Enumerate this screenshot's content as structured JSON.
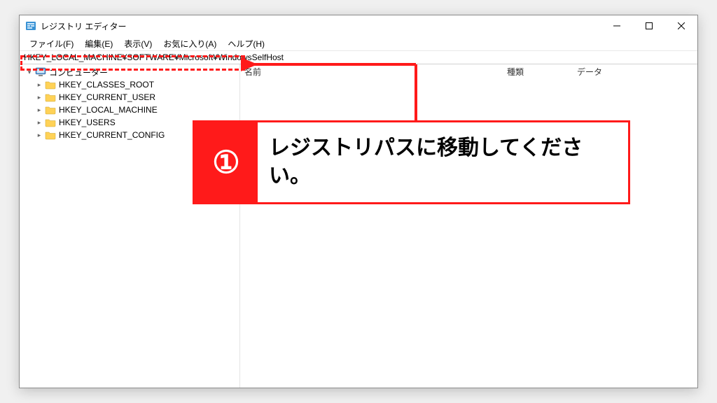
{
  "window": {
    "title": "レジストリ エディター"
  },
  "menu": {
    "file": "ファイル(F)",
    "edit": "編集(E)",
    "view": "表示(V)",
    "fav": "お気に入り(A)",
    "help": "ヘルプ(H)"
  },
  "address": {
    "value": "HKEY_LOCAL_MACHINE¥SOFTWARE¥Microsoft¥WindowsSelfHost"
  },
  "tree": {
    "root_label": "コンピューター",
    "hives": [
      "HKEY_CLASSES_ROOT",
      "HKEY_CURRENT_USER",
      "HKEY_LOCAL_MACHINE",
      "HKEY_USERS",
      "HKEY_CURRENT_CONFIG"
    ]
  },
  "columns": {
    "name": "名前",
    "type": "種類",
    "data": "データ"
  },
  "annotation": {
    "badge": "①",
    "text": "レジストリパスに移動してください。"
  },
  "colors": {
    "accent_red": "#ff1a1a",
    "folder_yellow": "#ffd257"
  }
}
